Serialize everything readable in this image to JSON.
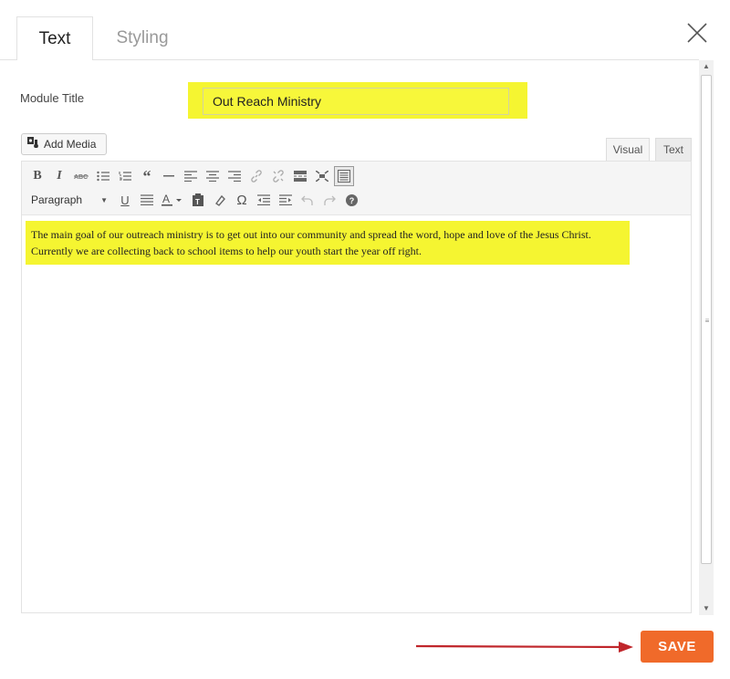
{
  "tabs": [
    {
      "label": "Text",
      "active": true
    },
    {
      "label": "Styling",
      "active": false
    }
  ],
  "module_title": {
    "label": "Module Title",
    "value": "Out Reach Ministry"
  },
  "add_media": {
    "label": "Add Media"
  },
  "editor_modes": {
    "visual": "Visual",
    "text": "Text"
  },
  "toolbar": {
    "paragraph_select": "Paragraph"
  },
  "content": {
    "text": "The main goal of our outreach ministry is to get out into our community and spread the word, hope and love of the Jesus Christ. Currently we are collecting back to school items to help our youth start the year off right."
  },
  "save": {
    "label": "SAVE"
  },
  "colors": {
    "highlight": "#f5f531",
    "save": "#f06a2a",
    "arrow": "#c0262b"
  }
}
